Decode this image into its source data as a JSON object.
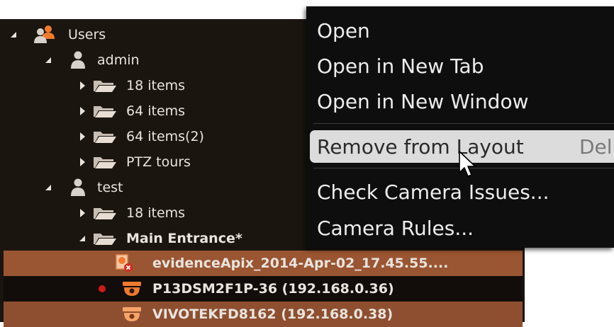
{
  "tree": {
    "users_root": "Users",
    "admin": "admin",
    "admin_items": [
      "18 items",
      "64 items",
      "64 items(2)",
      "PTZ tours"
    ],
    "test": "test",
    "test_item": "18 items",
    "layout": "Main Entrance*",
    "evidence": "evidenceApix_2014-Apr-02_17.45.55....",
    "camera1": "P13DSM2F1P-36 (192.168.0.36)",
    "camera2": "VIVOTEKFD8162 (192.168.0.38)"
  },
  "context_menu": {
    "open": "Open",
    "open_new_tab": "Open in New Tab",
    "open_new_window": "Open in New Window",
    "remove_from_layout": "Remove from Layout",
    "remove_shortcut": "Del",
    "check_camera_issues": "Check Camera Issues...",
    "camera_rules": "Camera Rules..."
  },
  "colors": {
    "tree_bg": "#1b1510",
    "selection": "#9a5532",
    "menu_bg": "#0e0e0f",
    "menu_highlight": "#dcdcdc",
    "folder": "#e8ddd2",
    "camera_orange": "#f07a2e",
    "recording": "#d01919"
  }
}
